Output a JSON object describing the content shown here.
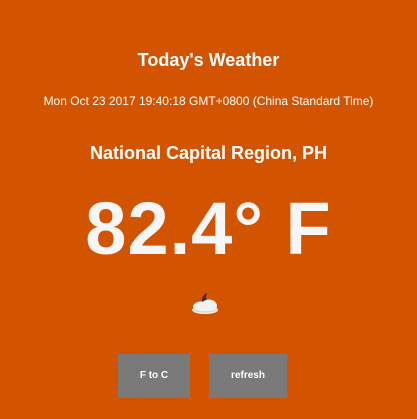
{
  "header": {
    "title": "Today's Weather",
    "datetime": "Mon Oct 23 2017 19:40:18 GMT+0800 (China Standard Time)"
  },
  "weather": {
    "location": "National Capital Region, PH",
    "temperature": "82.4° F",
    "icon": "cloudy-night-icon"
  },
  "actions": {
    "f_to_c_label": "F to C",
    "refresh_label": "refresh"
  },
  "colors": {
    "background": "#d35400",
    "button": "#7a7a7a",
    "text": "#ffffff"
  }
}
